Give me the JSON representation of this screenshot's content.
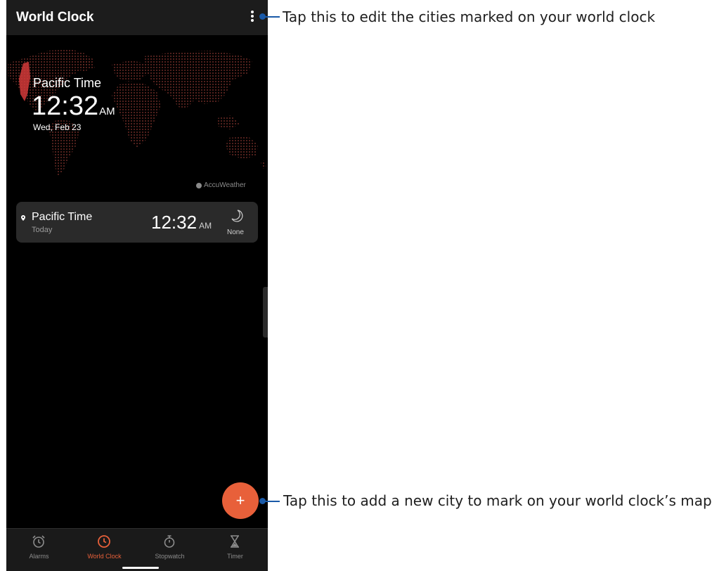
{
  "appbar": {
    "title": "World Clock"
  },
  "map": {
    "city": "Pacific Time",
    "time": "12:32",
    "ampm": "AM",
    "date": "Wed, Feb 23",
    "attribution": "AccuWeather"
  },
  "cities": [
    {
      "name": "Pacific Time",
      "day": "Today",
      "time": "12:32",
      "ampm": "AM",
      "weather": "None",
      "icon": "moon-icon"
    }
  ],
  "fab": {
    "label": "+"
  },
  "nav": [
    {
      "label": "Alarms",
      "icon": "alarm-clock-icon"
    },
    {
      "label": "World Clock",
      "icon": "clock-icon",
      "active": true
    },
    {
      "label": "Stopwatch",
      "icon": "stopwatch-icon"
    },
    {
      "label": "Timer",
      "icon": "hourglass-icon"
    }
  ],
  "callouts": {
    "menu": "Tap this to edit the cities marked on your world clock",
    "add": "Tap this to add a new city to mark on your world clock’s map."
  },
  "colors": {
    "accent": "#e8603a",
    "callout": "#1a5aa8",
    "map_dots": "#6b2a24"
  }
}
